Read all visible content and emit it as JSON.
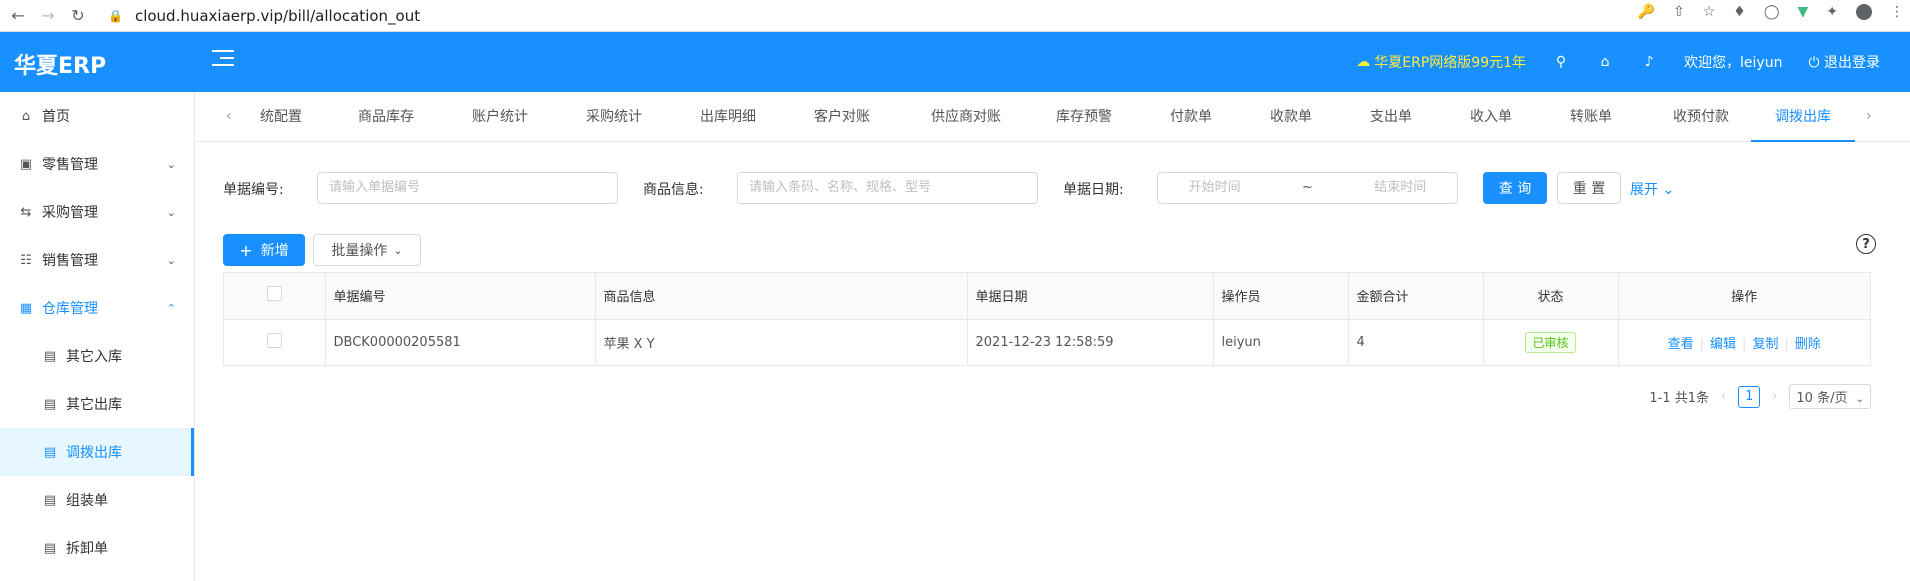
{
  "browser": {
    "url": "cloud.huaxiaerp.vip/bill/allocation_out"
  },
  "header": {
    "logo": "华夏ERP",
    "promo": "华夏ERP网络版99元1年",
    "welcome": "欢迎您，leiyun",
    "logout": "退出登录"
  },
  "sidebar": {
    "items": [
      {
        "label": "首页",
        "icon": "home-icon"
      },
      {
        "label": "零售管理",
        "icon": "shop-icon"
      },
      {
        "label": "采购管理",
        "icon": "swap-icon"
      },
      {
        "label": "销售管理",
        "icon": "cart-icon"
      },
      {
        "label": "仓库管理",
        "icon": "warehouse-icon"
      }
    ],
    "subitems": [
      {
        "label": "其它入库"
      },
      {
        "label": "其它出库"
      },
      {
        "label": "调拨出库"
      },
      {
        "label": "组装单"
      },
      {
        "label": "拆卸单"
      }
    ]
  },
  "tabs": [
    {
      "label": "统配置"
    },
    {
      "label": "商品库存"
    },
    {
      "label": "账户统计"
    },
    {
      "label": "采购统计"
    },
    {
      "label": "出库明细"
    },
    {
      "label": "客户对账"
    },
    {
      "label": "供应商对账"
    },
    {
      "label": "库存预警"
    },
    {
      "label": "付款单"
    },
    {
      "label": "收款单"
    },
    {
      "label": "支出单"
    },
    {
      "label": "收入单"
    },
    {
      "label": "转账单"
    },
    {
      "label": "收预付款"
    },
    {
      "label": "调拨出库"
    }
  ],
  "filters": {
    "bill_no_label": "单据编号:",
    "bill_no_placeholder": "请输入单据编号",
    "goods_label": "商品信息:",
    "goods_placeholder": "请输入条码、名称、规格、型号",
    "date_label": "单据日期:",
    "date_start_placeholder": "开始时间",
    "date_sep": "~",
    "date_end_placeholder": "结束时间",
    "query": "查 询",
    "reset": "重 置",
    "expand": "展开"
  },
  "toolbar": {
    "add": "新增",
    "batch": "批量操作"
  },
  "table": {
    "headers": [
      "单据编号",
      "商品信息",
      "单据日期",
      "操作员",
      "金额合计",
      "状态",
      "操作"
    ],
    "rows": [
      {
        "bill_no": "DBCK00000205581",
        "goods": "苹果 X Y",
        "date": "2021-12-23 12:58:59",
        "operator": "leiyun",
        "amount": "4",
        "status": "已审核",
        "actions": [
          "查看",
          "编辑",
          "复制",
          "删除"
        ]
      }
    ]
  },
  "pager": {
    "total": "1-1 共1条",
    "page": "1",
    "size": "10 条/页"
  },
  "colors": {
    "primary": "#1890ff",
    "promo": "#ffeb3b",
    "success": "#52c41a"
  }
}
